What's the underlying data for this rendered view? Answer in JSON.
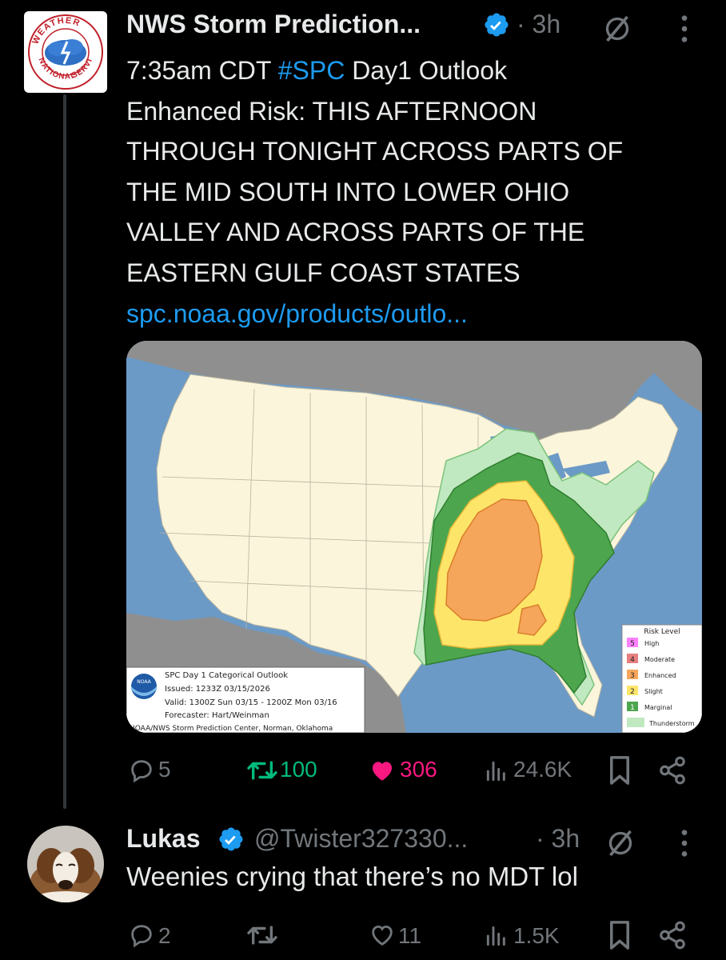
{
  "colors": {
    "background": "#000000",
    "text": "#e7e9ea",
    "muted": "#71767b",
    "link": "#1d9bf0",
    "retweet": "#00ba7c",
    "like": "#f91880",
    "verified": "#1d9bf0"
  },
  "tweet": {
    "author_name": "NWS Storm Prediction...",
    "time": "· 3h",
    "text_time": "7:35am CDT ",
    "hashtag": "#SPC",
    "text_line1_rest": " Day1 Outlook",
    "text_lines": [
      "Enhanced Risk: THIS AFTERNOON",
      "THROUGH TONIGHT ACROSS PARTS OF",
      "THE MID SOUTH INTO LOWER OHIO",
      "VALLEY AND ACROSS PARTS OF THE",
      "EASTERN GULF COAST STATES"
    ],
    "link": "spc.noaa.gov/products/outlo...",
    "stats": {
      "replies": "5",
      "retweets": "100",
      "likes": "306",
      "views": "24.6K"
    },
    "avatar_icon": "nws-logo-icon",
    "avatar_logo_text": {
      "left": "NATIONAL",
      "top": "WEATHER",
      "right": "SERVICE"
    }
  },
  "map": {
    "legend_title": "Risk Level",
    "legend_items": [
      {
        "num": "5",
        "label": "High",
        "color": "#ff80ff"
      },
      {
        "num": "4",
        "label": "Moderate",
        "color": "#e67f7f"
      },
      {
        "num": "3",
        "label": "Enhanced",
        "color": "#f6a65b"
      },
      {
        "num": "2",
        "label": "Slight",
        "color": "#fde56a"
      },
      {
        "num": "1",
        "label": "Marginal",
        "color": "#4da64d"
      },
      {
        "num": "",
        "label": "Thunderstorm",
        "color": "#c1e9c1"
      }
    ],
    "info": {
      "logo": "NOAA",
      "title": "SPC Day 1 Categorical Outlook",
      "issued": "Issued: 1233Z 03/15/2026",
      "valid": "Valid: 1300Z Sun 03/15 - 1200Z Mon 03/16",
      "forecaster": "Forecaster: Hart/Weinman",
      "footer": "NOAA/NWS Storm Prediction Center, Norman, Oklahoma"
    }
  },
  "reply": {
    "author_name": "Lukas",
    "handle": "@Twister327330...",
    "time": "· 3h",
    "text": "Weenies crying that there’s no MDT lol",
    "stats": {
      "replies": "2",
      "retweets": "",
      "likes": "11",
      "views": "1.5K"
    }
  }
}
